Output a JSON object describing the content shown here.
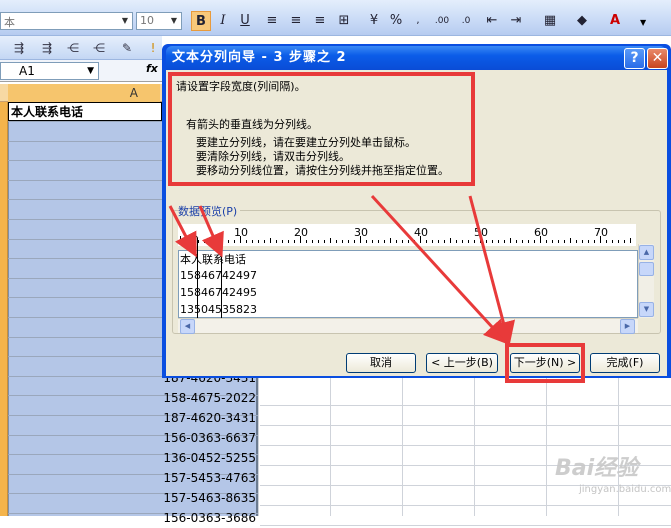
{
  "window": {
    "title": "文本分列向导 - 3 步骤之 2"
  },
  "toolbar": {
    "font_name": "本",
    "font_size": "10",
    "bold": "B",
    "italic": "I",
    "underline": "U",
    "percent": "%",
    "font_color_label": "A"
  },
  "formula_bar": {
    "name_box": "A1",
    "fx": "fx"
  },
  "sheet": {
    "column_header": "A",
    "header_cell": "本人联系电话",
    "rows": [
      "187-4620-3431",
      "158-4675-2022",
      "187-4620-3431",
      "156-0363-6637",
      "136-0452-5255",
      "157-5453-4763",
      "157-5463-8635",
      "156-0363-3686"
    ]
  },
  "dialog": {
    "instruction": "请设置字段宽度(列间隔)。",
    "info_title": "有箭头的垂直线为分列线。",
    "info_lines": [
      "要建立分列线，请在要建立分列处单击鼠标。",
      "要清除分列线，请双击分列线。",
      "要移动分列线位置，请按住分列线并拖至指定位置。"
    ],
    "preview_label": "数据预览(P)",
    "ruler_labels": [
      "10",
      "20",
      "30",
      "40",
      "50",
      "60",
      "70"
    ],
    "preview_lines": [
      "本人联系电话",
      "15846742497",
      "15846742495",
      "13504535823"
    ],
    "buttons": {
      "cancel": "取消",
      "back": "< 上一步(B)",
      "next": "下一步(N) >",
      "finish": "完成(F)"
    }
  },
  "watermark": {
    "text": "Bai经验",
    "url": "jingyan.baidu.com"
  },
  "colors": {
    "title_bar": "#0b5ce8",
    "highlight": "#e83a3a",
    "selection": "#b4c6e7",
    "dialog_body": "#ece9d8"
  }
}
